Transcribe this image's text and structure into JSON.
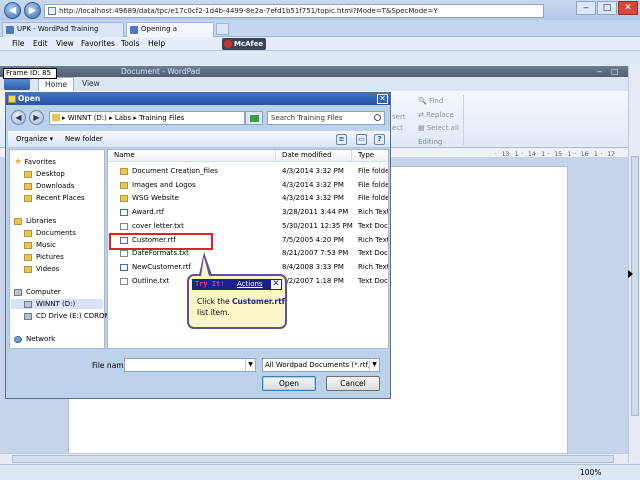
{
  "browser": {
    "address": "http://localhost:49689/data/tpc/e17c0cf2-1d4b-4499-8e2a-7efd1b51f751/topic.html?Mode=T&SpecMode=Y",
    "tabs": [
      {
        "label": "UPK - WordPad Training"
      },
      {
        "label": "Opening a Document"
      }
    ],
    "menu": [
      "File",
      "Edit",
      "View",
      "Favorites",
      "Tools",
      "Help"
    ],
    "addon": "McAfee"
  },
  "frame_id": "Frame ID:  85",
  "wordpad": {
    "title": "Document - WordPad",
    "ribbon_tabs": [
      "Home",
      "View"
    ],
    "ribbon": {
      "find": "Find",
      "replace": "Replace",
      "select_all": "Select all",
      "group_editing": "Editing",
      "insert_partial": "sert",
      "object_partial": "ect"
    },
    "ruler_marks": [
      "·",
      "13",
      "·",
      "1",
      "·",
      "14",
      "·",
      "1",
      "·",
      "15",
      "·",
      "1",
      "·",
      "16",
      "·",
      "1",
      "·",
      "17",
      "·"
    ],
    "zoom": "100%"
  },
  "dialog": {
    "title": "Open",
    "breadcrumb": "▸ WINNT (D:) ▸ Labs ▸ Training Files",
    "search_placeholder": "Search Training Files",
    "toolbar": {
      "organize": "Organize ▾",
      "new_folder": "New folder"
    },
    "nav": {
      "favorites": "Favorites",
      "desktop": "Desktop",
      "downloads": "Downloads",
      "recent": "Recent Places",
      "libraries": "Libraries",
      "documents": "Documents",
      "music": "Music",
      "pictures": "Pictures",
      "videos": "Videos",
      "computer": "Computer",
      "winnt": "WINNT (D:)",
      "cd": "CD Drive (E:) CDROM",
      "network": "Network"
    },
    "columns": {
      "name": "Name",
      "date": "Date modified",
      "type": "Type"
    },
    "files": [
      {
        "name": "Document Creation_files",
        "date": "4/3/2014 3:32 PM",
        "type": "File folder",
        "kind": "folder"
      },
      {
        "name": "Images and Logos",
        "date": "4/3/2014 3:32 PM",
        "type": "File folder",
        "kind": "folder"
      },
      {
        "name": "WSG Website",
        "date": "4/3/2014 3:32 PM",
        "type": "File folder",
        "kind": "folder"
      },
      {
        "name": "Award.rtf",
        "date": "3/28/2011 3:44 PM",
        "type": "Rich Text Fo",
        "kind": "rtf"
      },
      {
        "name": "cover letter.txt",
        "date": "5/30/2011 12:35 PM",
        "type": "Text Docum",
        "kind": "txt"
      },
      {
        "name": "Customer.rtf",
        "date": "7/5/2005 4:20 PM",
        "type": "Rich Text Fo",
        "kind": "rtf"
      },
      {
        "name": "DateFormats.txt",
        "date": "8/21/2007 7:53 PM",
        "type": "Text Docum",
        "kind": "txt"
      },
      {
        "name": "NewCustomer.rtf",
        "date": "8/4/2008 3:33 PM",
        "type": "Rich Text Fo",
        "kind": "rtf"
      },
      {
        "name": "Outline.txt",
        "date": "7/2/2007 1:18 PM",
        "type": "Text Docum",
        "kind": "txt"
      }
    ],
    "file_name_label": "File name:",
    "file_name_value": "",
    "file_type": "All Wordpad Documents (*.rtf, *.",
    "open_button": "Open",
    "cancel_button": "Cancel"
  },
  "callout": {
    "try_it": "Try It!",
    "actions": "Actions",
    "text_before": "Click the ",
    "text_bold": "Customer.rtf",
    "text_after": " list item."
  }
}
